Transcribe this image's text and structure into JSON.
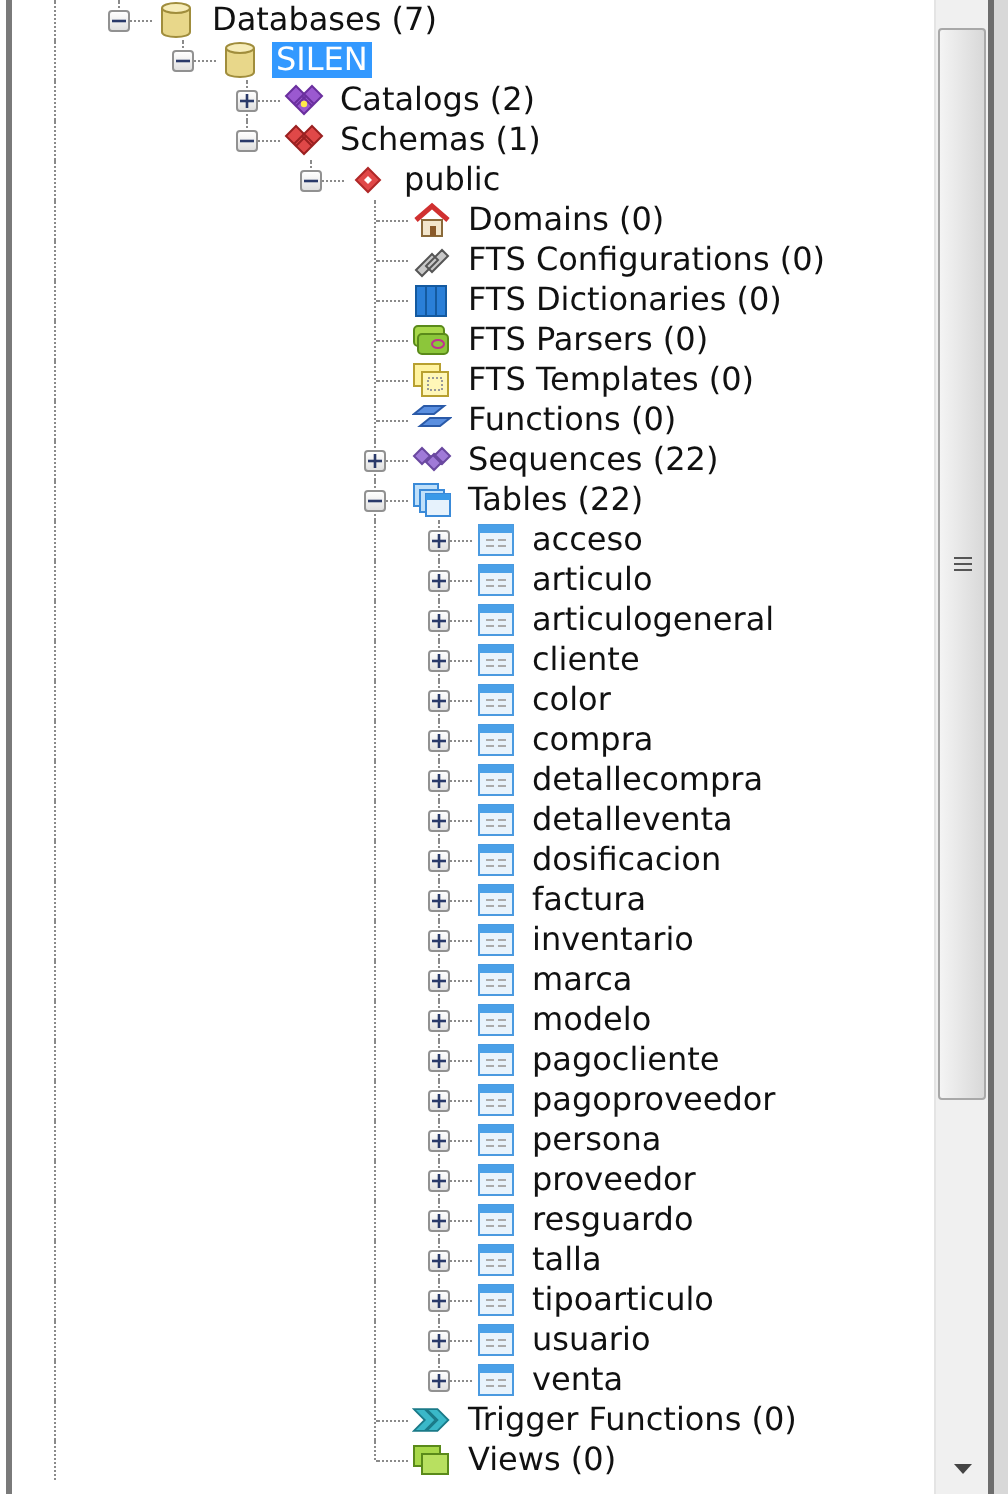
{
  "tree": [
    {
      "label": "Databases (7)",
      "kind": "database",
      "expanded": true,
      "selected": false,
      "children": [
        {
          "label": "SILEN",
          "kind": "database",
          "expanded": true,
          "selected": true,
          "children": [
            {
              "label": "Catalogs (2)",
              "kind": "catalogs",
              "expanded": false,
              "selected": false
            },
            {
              "label": "Schemas (1)",
              "kind": "schemas",
              "expanded": true,
              "selected": false,
              "children": [
                {
                  "label": "public",
                  "kind": "schema",
                  "expanded": true,
                  "selected": false,
                  "children": [
                    {
                      "label": "Domains (0)",
                      "kind": "domains",
                      "selected": false
                    },
                    {
                      "label": "FTS Configurations (0)",
                      "kind": "fts-config",
                      "selected": false
                    },
                    {
                      "label": "FTS Dictionaries (0)",
                      "kind": "fts-dict",
                      "selected": false
                    },
                    {
                      "label": "FTS Parsers (0)",
                      "kind": "fts-parser",
                      "selected": false
                    },
                    {
                      "label": "FTS Templates (0)",
                      "kind": "fts-template",
                      "selected": false
                    },
                    {
                      "label": "Functions (0)",
                      "kind": "functions",
                      "selected": false
                    },
                    {
                      "label": "Sequences (22)",
                      "kind": "sequences",
                      "expanded": false,
                      "selected": false
                    },
                    {
                      "label": "Tables (22)",
                      "kind": "tables",
                      "expanded": true,
                      "selected": false,
                      "children": [
                        {
                          "label": "acceso",
                          "kind": "table",
                          "expanded": false,
                          "selected": false
                        },
                        {
                          "label": "articulo",
                          "kind": "table",
                          "expanded": false,
                          "selected": false
                        },
                        {
                          "label": "articulogeneral",
                          "kind": "table",
                          "expanded": false,
                          "selected": false
                        },
                        {
                          "label": "cliente",
                          "kind": "table",
                          "expanded": false,
                          "selected": false
                        },
                        {
                          "label": "color",
                          "kind": "table",
                          "expanded": false,
                          "selected": false
                        },
                        {
                          "label": "compra",
                          "kind": "table",
                          "expanded": false,
                          "selected": false
                        },
                        {
                          "label": "detallecompra",
                          "kind": "table",
                          "expanded": false,
                          "selected": false
                        },
                        {
                          "label": "detalleventa",
                          "kind": "table",
                          "expanded": false,
                          "selected": false
                        },
                        {
                          "label": "dosificacion",
                          "kind": "table",
                          "expanded": false,
                          "selected": false
                        },
                        {
                          "label": "factura",
                          "kind": "table",
                          "expanded": false,
                          "selected": false
                        },
                        {
                          "label": "inventario",
                          "kind": "table",
                          "expanded": false,
                          "selected": false
                        },
                        {
                          "label": "marca",
                          "kind": "table",
                          "expanded": false,
                          "selected": false
                        },
                        {
                          "label": "modelo",
                          "kind": "table",
                          "expanded": false,
                          "selected": false
                        },
                        {
                          "label": "pagocliente",
                          "kind": "table",
                          "expanded": false,
                          "selected": false
                        },
                        {
                          "label": "pagoproveedor",
                          "kind": "table",
                          "expanded": false,
                          "selected": false
                        },
                        {
                          "label": "persona",
                          "kind": "table",
                          "expanded": false,
                          "selected": false
                        },
                        {
                          "label": "proveedor",
                          "kind": "table",
                          "expanded": false,
                          "selected": false
                        },
                        {
                          "label": "resguardo",
                          "kind": "table",
                          "expanded": false,
                          "selected": false
                        },
                        {
                          "label": "talla",
                          "kind": "table",
                          "expanded": false,
                          "selected": false
                        },
                        {
                          "label": "tipoarticulo",
                          "kind": "table",
                          "expanded": false,
                          "selected": false
                        },
                        {
                          "label": "usuario",
                          "kind": "table",
                          "expanded": false,
                          "selected": false
                        },
                        {
                          "label": "venta",
                          "kind": "table",
                          "expanded": false,
                          "selected": false
                        }
                      ]
                    },
                    {
                      "label": "Trigger Functions (0)",
                      "kind": "trigger-functions",
                      "selected": false
                    },
                    {
                      "label": "Views (0)",
                      "kind": "views",
                      "selected": false
                    }
                  ]
                }
              ]
            }
          ]
        }
      ]
    }
  ]
}
